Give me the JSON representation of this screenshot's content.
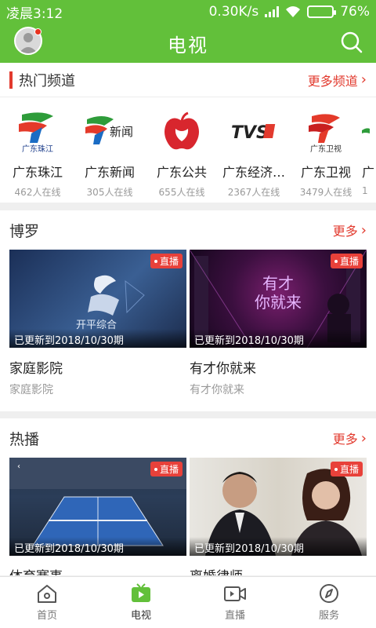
{
  "status_bar": {
    "time": "凌晨3:12",
    "network_speed": "0.30K/s",
    "battery": "76%",
    "battery_level": 0.76
  },
  "header": {
    "title": "电视",
    "avatar_icon": "user-avatar-icon",
    "search_icon": "search-icon"
  },
  "hot_channels": {
    "title": "热门频道",
    "more_label": "更多频道",
    "items": [
      {
        "name": "广东珠江",
        "online": "462人在线",
        "logo_text": "广东珠江"
      },
      {
        "name": "广东新闻",
        "online": "305人在线",
        "logo_text": "新闻"
      },
      {
        "name": "广东公共",
        "online": "655人在线",
        "logo_text": ""
      },
      {
        "name": "广东经济…",
        "online": "2367人在线",
        "logo_text": "TVS"
      },
      {
        "name": "广东卫视",
        "online": "3479人在线",
        "logo_text": "广东卫视"
      },
      {
        "name": "广",
        "online": "1",
        "logo_text": ""
      }
    ]
  },
  "groups": [
    {
      "title": "博罗",
      "more_label": "更多",
      "cards": [
        {
          "title": "家庭影院",
          "subtitle": "家庭影院",
          "live": "直播",
          "update": "已更新到2018/10/30期",
          "thumb_text": "开平综合"
        },
        {
          "title": "有才你就来",
          "subtitle": "有才你就来",
          "live": "直播",
          "update": "已更新到2018/10/30期",
          "thumb_text": "有才你就来"
        }
      ]
    },
    {
      "title": "热播",
      "more_label": "更多",
      "cards": [
        {
          "title": "体育赛事",
          "subtitle": "",
          "live": "直播",
          "update": "已更新到2018/10/30期"
        },
        {
          "title": "离婚律师",
          "subtitle": "",
          "live": "直播",
          "update": "已更新到2018/10/30期"
        }
      ]
    }
  ],
  "tabbar": {
    "tabs": [
      {
        "label": "首页",
        "icon": "home-icon"
      },
      {
        "label": "电视",
        "icon": "tv-icon"
      },
      {
        "label": "直播",
        "icon": "live-camera-icon"
      },
      {
        "label": "服务",
        "icon": "compass-icon"
      }
    ],
    "active": "电视"
  },
  "colors": {
    "brand_green": "#62c03a",
    "accent_red": "#e23a2e",
    "live_tag": "#e8413a"
  }
}
